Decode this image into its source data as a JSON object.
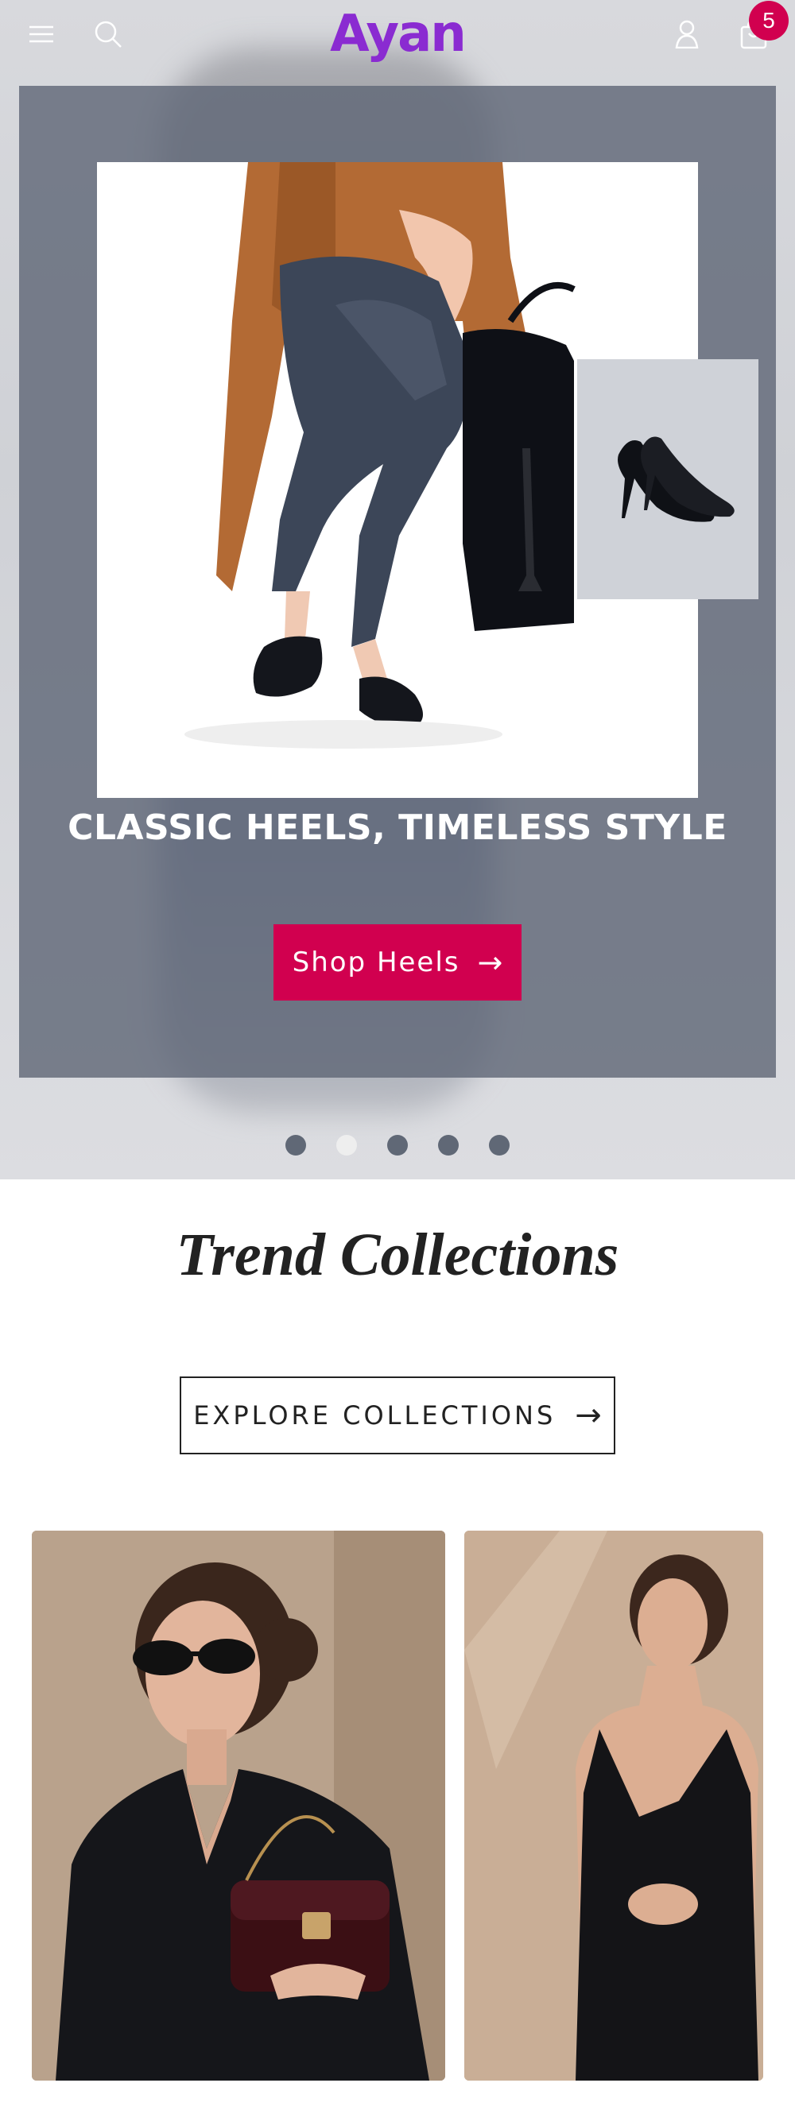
{
  "header": {
    "logo": "Ayan",
    "cart_count": "5",
    "icons": [
      "menu-icon",
      "search-icon",
      "account-icon",
      "cart-icon"
    ]
  },
  "hero": {
    "heading": "CLASSIC HEELS, TIMELESS STYLE",
    "cta_label": "Shop Heels",
    "cta_arrow": "→",
    "slides_total": 5,
    "active_slide": 2
  },
  "collections": {
    "title": "Trend Collections",
    "explore_label": "EXPLORE COLLECTIONS",
    "explore_arrow": "→"
  },
  "colors": {
    "brand": "#8a2bd1",
    "accent": "#d1004f"
  }
}
